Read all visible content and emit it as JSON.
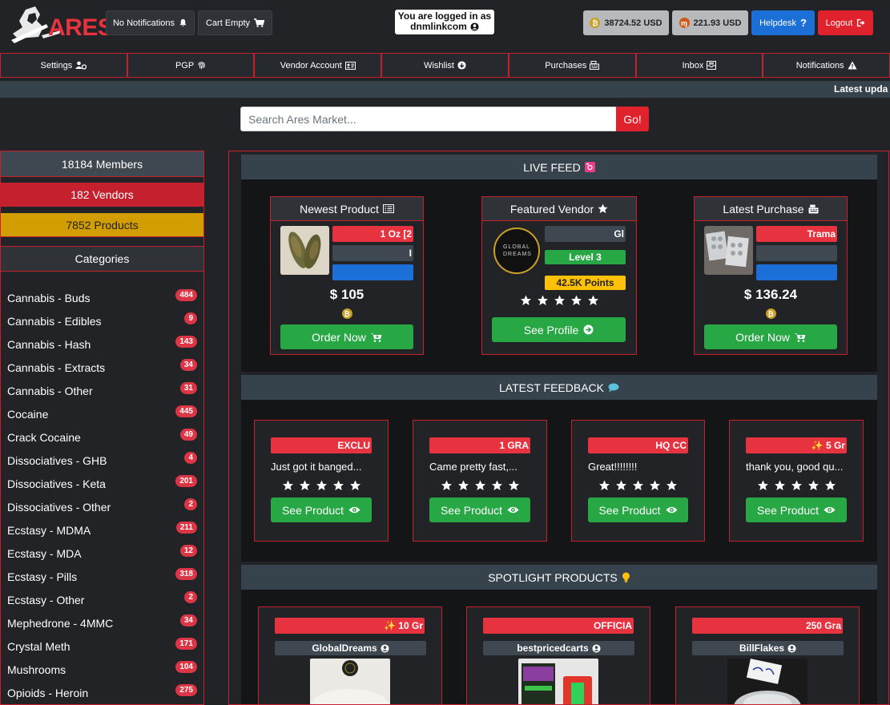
{
  "header": {
    "logo_text": "ARES",
    "notifications_label": "No Notifications",
    "cart_label": "Cart Empty",
    "logged_in_line1": "You are logged in as",
    "username": "dnmlinkcom",
    "btc_balance": "38724.52 USD",
    "xmr_balance": "221.93 USD",
    "helpdesk_label": "Helpdesk",
    "logout_label": "Logout"
  },
  "nav": {
    "items": [
      {
        "label": "Settings",
        "icon": "users-cog-icon"
      },
      {
        "label": "PGP",
        "icon": "fingerprint-icon"
      },
      {
        "label": "Vendor Account",
        "icon": "id-card-icon"
      },
      {
        "label": "Wishlist",
        "icon": "arrow-circle-down-icon"
      },
      {
        "label": "Purchases",
        "icon": "cash-register-icon"
      },
      {
        "label": "Inbox",
        "icon": "inbox-icon"
      },
      {
        "label": "Notifications",
        "icon": "warning-icon"
      }
    ]
  },
  "ticker": {
    "text": "Latest upda"
  },
  "search": {
    "placeholder": "Search Ares Market...",
    "button_label": "Go!"
  },
  "sidebar": {
    "members": "18184 Members",
    "vendors": "182 Vendors",
    "products": "7852 Products",
    "categories_title": "Categories",
    "categories": [
      {
        "name": "Cannabis - Buds",
        "count": "484"
      },
      {
        "name": "Cannabis - Edibles",
        "count": "9"
      },
      {
        "name": "Cannabis - Hash",
        "count": "143"
      },
      {
        "name": "Cannabis - Extracts",
        "count": "34"
      },
      {
        "name": "Cannabis - Other",
        "count": "31"
      },
      {
        "name": "Cocaine",
        "count": "445"
      },
      {
        "name": "Crack Cocaine",
        "count": "49"
      },
      {
        "name": "Dissociatives - GHB",
        "count": "4"
      },
      {
        "name": "Dissociatives - Keta",
        "count": "201"
      },
      {
        "name": "Dissociatives - Other",
        "count": "2"
      },
      {
        "name": "Ecstasy - MDMA",
        "count": "211"
      },
      {
        "name": "Ecstasy - MDA",
        "count": "12"
      },
      {
        "name": "Ecstasy - Pills",
        "count": "318"
      },
      {
        "name": "Ecstasy - Other",
        "count": "2"
      },
      {
        "name": "Mephedrone - 4MMC",
        "count": "34"
      },
      {
        "name": "Crystal Meth",
        "count": "171"
      },
      {
        "name": "Mushrooms",
        "count": "104"
      },
      {
        "name": "Opioids - Heroin",
        "count": "275"
      }
    ]
  },
  "live_feed": {
    "title": "LIVE FEED",
    "newest_product": {
      "title": "Newest Product",
      "name_snippet": "1 Oz [2",
      "vendor_snippet": "I",
      "price": "$ 105",
      "order_label": "Order Now"
    },
    "featured_vendor": {
      "title": "Featured Vendor",
      "logo_text": "GLOBAL DREAMS",
      "name_snippet": "Gl",
      "level": "Level 3",
      "points": "42.5K Points",
      "rating": 5,
      "profile_label": "See Profile"
    },
    "latest_purchase": {
      "title": "Latest Purchase",
      "name_snippet": "Trama",
      "price": "$ 136.24",
      "order_label": "Order Now"
    }
  },
  "latest_feedback": {
    "title": "LATEST FEEDBACK",
    "items": [
      {
        "product_snippet": "EXCLU",
        "text": "Just got it banged...",
        "rating": 5,
        "button": "See Product"
      },
      {
        "product_snippet": "1 GRA",
        "text": "Came pretty fast,...",
        "rating": 5,
        "button": "See Product"
      },
      {
        "product_snippet": "HQ CC",
        "text": "Great!!!!!!!!",
        "rating": 5,
        "button": "See Product"
      },
      {
        "product_snippet": "✨ 5 Gr",
        "text": "thank you, good qu...",
        "rating": 5,
        "button": "See Product"
      }
    ]
  },
  "spotlight": {
    "title": "SPOTLIGHT PRODUCTS",
    "items": [
      {
        "product_snippet": "✨ 10 Gr",
        "vendor": "GlobalDreams"
      },
      {
        "product_snippet": "OFFICIA",
        "vendor": "bestpricedcarts"
      },
      {
        "product_snippet": "250 Gra",
        "vendor": "BillFlakes"
      }
    ]
  },
  "colors": {
    "accent_red": "#e0222d",
    "border_red": "#c4202d",
    "green": "#28a745",
    "blue": "#1b6fd6",
    "gold": "#d19d00",
    "slate": "#36434d"
  }
}
